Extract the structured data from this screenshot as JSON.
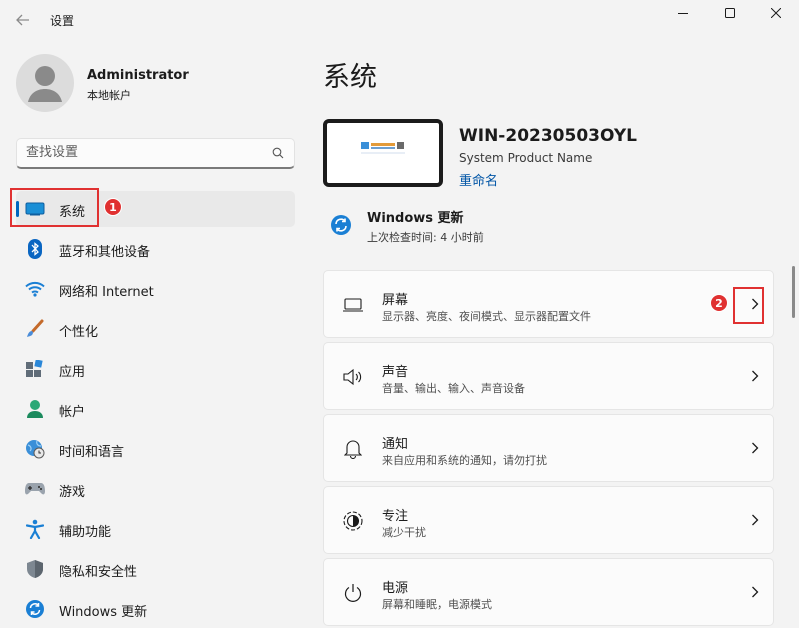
{
  "window": {
    "title": "设置"
  },
  "user": {
    "name": "Administrator",
    "account_type": "本地帐户"
  },
  "search": {
    "placeholder": "查找设置"
  },
  "nav": [
    {
      "label": "系统",
      "icon": "display-icon",
      "active": true
    },
    {
      "label": "蓝牙和其他设备",
      "icon": "bluetooth-icon"
    },
    {
      "label": "网络和 Internet",
      "icon": "wifi-icon"
    },
    {
      "label": "个性化",
      "icon": "brush-icon"
    },
    {
      "label": "应用",
      "icon": "apps-icon"
    },
    {
      "label": "帐户",
      "icon": "person-icon"
    },
    {
      "label": "时间和语言",
      "icon": "globe-clock-icon"
    },
    {
      "label": "游戏",
      "icon": "gamepad-icon"
    },
    {
      "label": "辅助功能",
      "icon": "accessibility-icon"
    },
    {
      "label": "隐私和安全性",
      "icon": "shield-icon"
    },
    {
      "label": "Windows 更新",
      "icon": "update-icon"
    }
  ],
  "annotations": {
    "badge1": "1",
    "badge2": "2"
  },
  "main": {
    "title": "系统",
    "device": {
      "name": "WIN-20230503OYL",
      "model": "System Product Name",
      "rename": "重命名"
    },
    "update": {
      "title": "Windows 更新",
      "subtitle": "上次检查时间: 4 小时前"
    },
    "cards": [
      {
        "title": "屏幕",
        "subtitle": "显示器、亮度、夜间模式、显示器配置文件",
        "icon": "monitor-icon"
      },
      {
        "title": "声音",
        "subtitle": "音量、输出、输入、声音设备",
        "icon": "speaker-icon"
      },
      {
        "title": "通知",
        "subtitle": "来自应用和系统的通知，请勿打扰",
        "icon": "bell-icon"
      },
      {
        "title": "专注",
        "subtitle": "减少干扰",
        "icon": "focus-icon"
      },
      {
        "title": "电源",
        "subtitle": "屏幕和睡眠，电源模式",
        "icon": "power-icon"
      }
    ]
  },
  "colors": {
    "accent": "#0067c0",
    "annotation": "#e03131"
  }
}
